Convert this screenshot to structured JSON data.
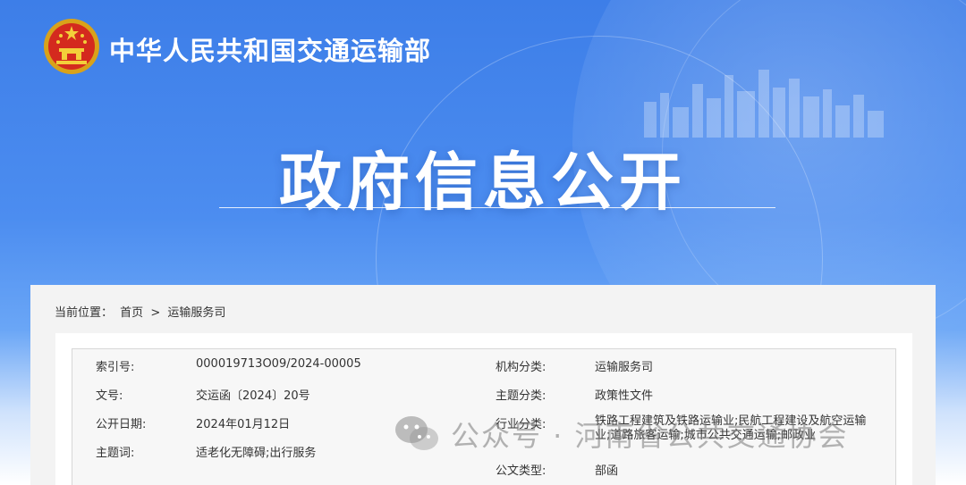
{
  "header": {
    "ministry": "中华人民共和国交通运输部",
    "title": "政府信息公开"
  },
  "breadcrumb": {
    "prefix": "当前位置：",
    "home": "首页",
    "separator": ">",
    "current": "运输服务司"
  },
  "meta": {
    "left": [
      {
        "label": "索引号:",
        "value": "000019713O09/2024-00005"
      },
      {
        "label": "文号:",
        "value": "交运函〔2024〕20号"
      },
      {
        "label": "公开日期:",
        "value": "2024年01月12日"
      },
      {
        "label": "主题词:",
        "value": "适老化无障碍;出行服务"
      }
    ],
    "right": [
      {
        "label": "机构分类:",
        "value": "运输服务司"
      },
      {
        "label": "主题分类:",
        "value": "政策性文件"
      },
      {
        "label": "行业分类:",
        "value": "铁路工程建筑及铁路运输业;民航工程建设及航空运输业;道路旅客运输;城市公共交通运输;邮政业"
      },
      {
        "label": "公文类型:",
        "value": "部函"
      }
    ]
  },
  "watermark": {
    "text": "公众号 · 河南省公共交通协会"
  },
  "colors": {
    "banner": "#4c8df0",
    "panel": "#f3f3f3"
  }
}
